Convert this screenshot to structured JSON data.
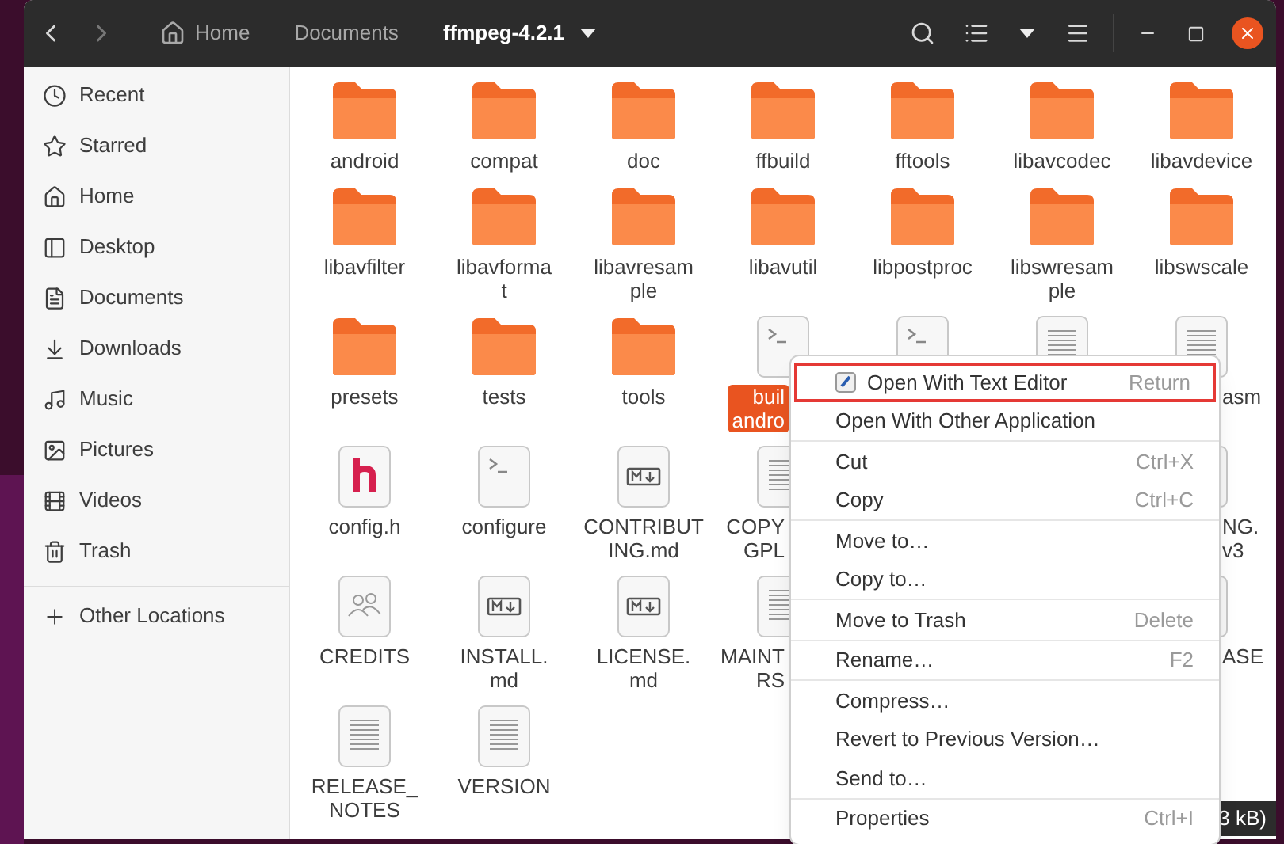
{
  "title_bar": {
    "path": [
      {
        "label": "Home",
        "home": true,
        "current": false
      },
      {
        "label": "Documents",
        "home": false,
        "current": false
      },
      {
        "label": "ffmpeg-4.2.1",
        "home": false,
        "current": true
      }
    ]
  },
  "sidebar": {
    "items": [
      {
        "label": "Recent"
      },
      {
        "label": "Starred"
      },
      {
        "label": "Home"
      },
      {
        "label": "Desktop"
      },
      {
        "label": "Documents"
      },
      {
        "label": "Downloads"
      },
      {
        "label": "Music"
      },
      {
        "label": "Pictures"
      },
      {
        "label": "Videos"
      },
      {
        "label": "Trash"
      }
    ],
    "other": {
      "label": "Other Locations"
    }
  },
  "files": [
    [
      {
        "kind": "folder",
        "lines": [
          "android"
        ],
        "selected": false
      },
      {
        "kind": "folder",
        "lines": [
          "compat"
        ],
        "selected": false
      },
      {
        "kind": "folder",
        "lines": [
          "doc"
        ],
        "selected": false
      },
      {
        "kind": "folder",
        "lines": [
          "ffbuild"
        ],
        "selected": false
      },
      {
        "kind": "folder",
        "lines": [
          "fftools"
        ],
        "selected": false
      },
      {
        "kind": "folder",
        "lines": [
          "libavcodec"
        ],
        "selected": false
      },
      {
        "kind": "folder",
        "lines": [
          "libavdevice"
        ],
        "selected": false
      }
    ],
    [
      {
        "kind": "folder",
        "lines": [
          "libavfilter"
        ],
        "selected": false
      },
      {
        "kind": "folder",
        "lines": [
          "libavforma",
          "t"
        ],
        "selected": false
      },
      {
        "kind": "folder",
        "lines": [
          "libavresam",
          "ple"
        ],
        "selected": false
      },
      {
        "kind": "folder",
        "lines": [
          "libavutil"
        ],
        "selected": false
      },
      {
        "kind": "folder",
        "lines": [
          "libpostproc"
        ],
        "selected": false
      },
      {
        "kind": "folder",
        "lines": [
          "libswresam",
          "ple"
        ],
        "selected": false
      },
      {
        "kind": "folder",
        "lines": [
          "libswscale"
        ],
        "selected": false
      }
    ],
    [
      {
        "kind": "folder",
        "lines": [
          "presets"
        ],
        "selected": false
      },
      {
        "kind": "folder",
        "lines": [
          "tests"
        ],
        "selected": false
      },
      {
        "kind": "folder",
        "lines": [
          "tools"
        ],
        "selected": false
      },
      {
        "kind": "script",
        "lines": [
          "buil",
          "andro"
        ],
        "selected": true
      },
      {
        "kind": "script"
      },
      {
        "kind": "text"
      },
      {
        "kind": "text",
        "lines": [
          "asm"
        ],
        "selected": false
      }
    ],
    [
      {
        "kind": "header",
        "lines": [
          "config.h"
        ],
        "selected": false
      },
      {
        "kind": "script",
        "lines": [
          "configure"
        ],
        "selected": false
      },
      {
        "kind": "markdown",
        "lines": [
          "CONTRIBUT",
          "ING.md"
        ],
        "selected": false
      },
      {
        "kind": "text",
        "lines": [
          "COPY",
          "GPL"
        ],
        "selected": false
      },
      {
        "kind": "text",
        "lines": [
          "NG.",
          "v3"
        ],
        "selected": false
      }
    ],
    [
      {
        "kind": "people",
        "lines": [
          "CREDITS"
        ],
        "selected": false
      },
      {
        "kind": "markdown",
        "lines": [
          "INSTALL.",
          "md"
        ],
        "selected": false
      },
      {
        "kind": "markdown",
        "lines": [
          "LICENSE.",
          "md"
        ],
        "selected": false
      },
      {
        "kind": "text",
        "lines": [
          "MAINT",
          "RS"
        ],
        "selected": false
      },
      {
        "kind": "text",
        "lines": [
          "ASE"
        ],
        "selected": false
      }
    ],
    [
      {
        "kind": "text",
        "lines": [
          "RELEASE_",
          "NOTES"
        ],
        "selected": false
      },
      {
        "kind": "text",
        "lines": [
          "VERSION"
        ],
        "selected": false
      }
    ]
  ],
  "status_bar": {
    "text": "3 kB)"
  },
  "context_menu": {
    "sections": [
      [
        {
          "label": "Open With Text Editor",
          "shortcut": "Return",
          "highlighted": true
        },
        {
          "label": "Open With Other Application",
          "highlighted": false
        }
      ],
      [
        {
          "label": "Cut",
          "shortcut": "Ctrl+X",
          "highlighted": false
        },
        {
          "label": "Copy",
          "shortcut": "Ctrl+C",
          "highlighted": false
        }
      ],
      [
        {
          "label": "Move to…",
          "highlighted": false
        },
        {
          "label": "Copy to…",
          "highlighted": false
        }
      ],
      [
        {
          "label": "Move to Trash",
          "shortcut": "Delete",
          "highlighted": false
        }
      ],
      [
        {
          "label": "Rename…",
          "shortcut": "F2",
          "highlighted": false
        }
      ],
      [
        {
          "label": "Compress…",
          "highlighted": false
        },
        {
          "label": "Revert to Previous Version…",
          "highlighted": false
        },
        {
          "label": "Send to…",
          "highlighted": false
        }
      ],
      [
        {
          "label": "Properties",
          "shortcut": "Ctrl+I",
          "highlighted": false
        }
      ]
    ]
  }
}
